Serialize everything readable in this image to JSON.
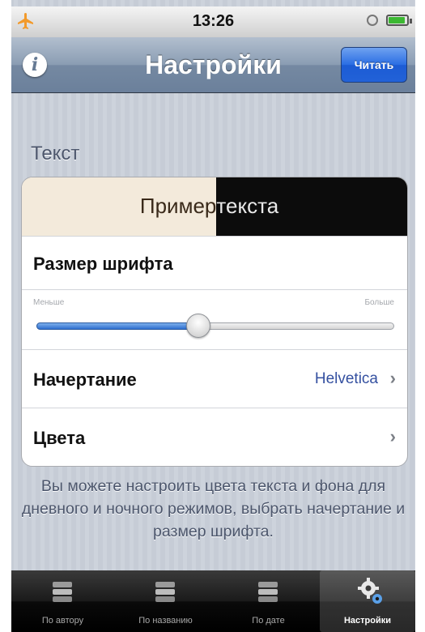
{
  "status_bar": {
    "time": "13:26"
  },
  "nav": {
    "title": "Настройки",
    "read_button": "Читать",
    "info_icon": "info-icon"
  },
  "section": {
    "header": "Текст"
  },
  "sample": {
    "left_text": "Пример",
    "right_text": "текста"
  },
  "font_size": {
    "label": "Размер шрифта",
    "min_label": "Меньше",
    "max_label": "Больше",
    "level": 0.45
  },
  "typeface": {
    "label": "Начертание",
    "value": "Helvetica"
  },
  "colors": {
    "label": "Цвета"
  },
  "footer_text": "Вы можете настроить цвета текста и фона для дневного и ночного режимов, выбрать начертание и размер шрифта.",
  "tabs": [
    {
      "label": "По автору",
      "icon": "books-icon",
      "active": false
    },
    {
      "label": "По названию",
      "icon": "books-icon",
      "active": false
    },
    {
      "label": "По дате",
      "icon": "books-icon",
      "active": false
    },
    {
      "label": "Настройки",
      "icon": "gears-icon",
      "active": true
    }
  ],
  "theme": {
    "accent": "#2a6de3",
    "value_color": "#3450a0",
    "light_bg": "#f3eadb",
    "dark_bg": "#0c0c0c"
  }
}
